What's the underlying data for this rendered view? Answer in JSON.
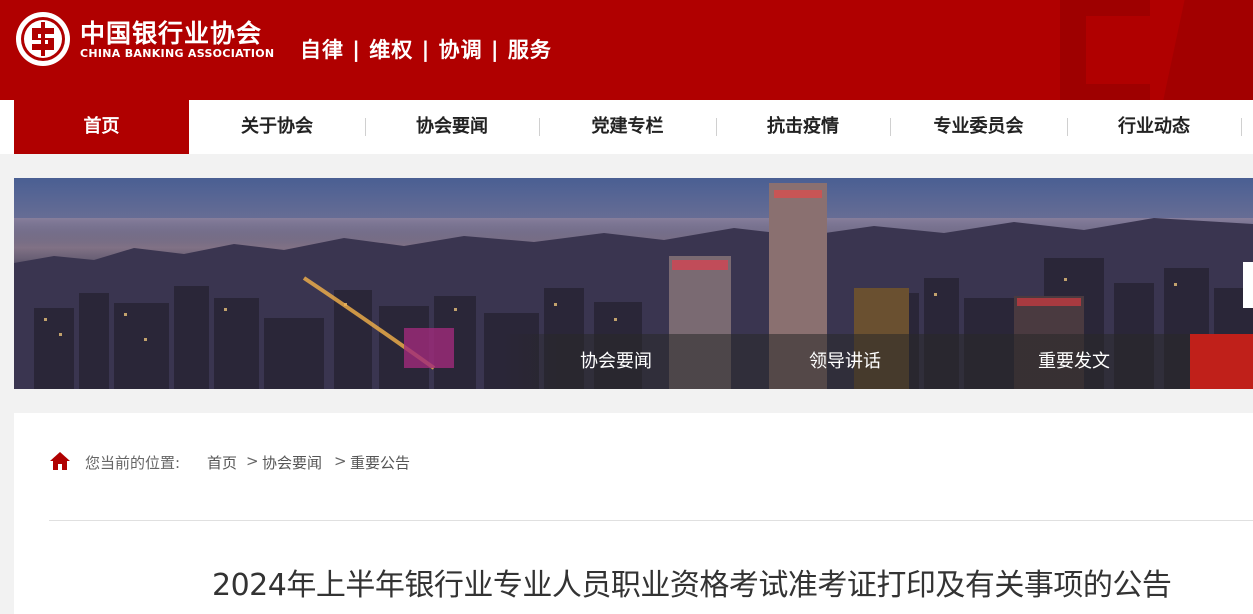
{
  "header": {
    "org_name_cn": "中国银行业协会",
    "org_name_en": "CHINA BANKING ASSOCIATION",
    "slogan": "自律 | 维权 | 协调 | 服务",
    "brand_color": "#b00000"
  },
  "nav": {
    "items": [
      {
        "label": "首页",
        "active": true
      },
      {
        "label": "关于协会",
        "active": false
      },
      {
        "label": "协会要闻",
        "active": false
      },
      {
        "label": "党建专栏",
        "active": false
      },
      {
        "label": "抗击疫情",
        "active": false
      },
      {
        "label": "专业委员会",
        "active": false
      },
      {
        "label": "行业动态",
        "active": false
      }
    ]
  },
  "banner": {
    "tabs": [
      {
        "label": "协会要闻"
      },
      {
        "label": "领导讲话"
      },
      {
        "label": "重要发文"
      }
    ]
  },
  "breadcrumb": {
    "prefix": "您当前的位置:",
    "items": [
      "首页",
      "协会要闻",
      "重要公告"
    ],
    "separator": ">",
    "icon": "home-icon"
  },
  "article": {
    "title": "2024年上半年银行业专业人员职业资格考试准考证打印及有关事项的公告"
  }
}
